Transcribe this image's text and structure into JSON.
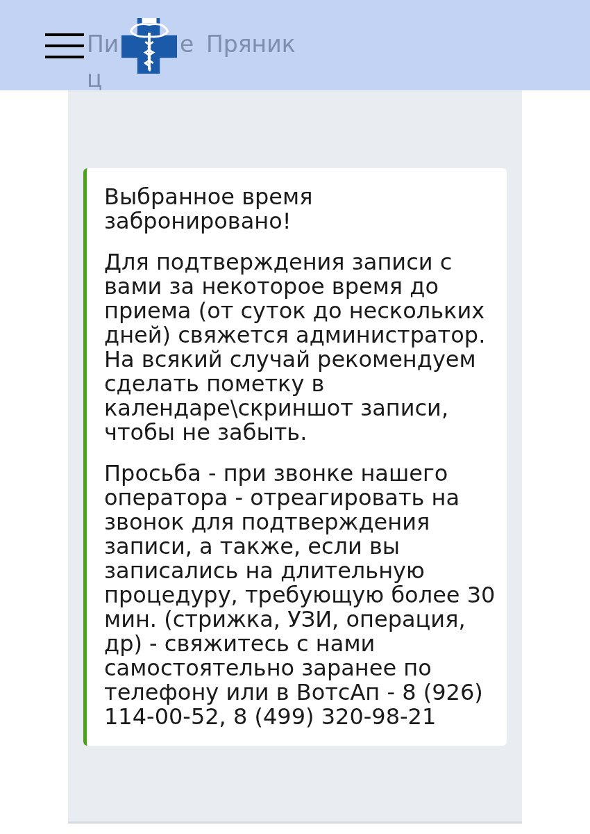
{
  "header": {
    "nav_fragments": [
      "Пи",
      "е",
      "ц"
    ],
    "nav_link": "Пряник"
  },
  "message": {
    "title": "Выбранное время забронировано!",
    "paragraphs": [
      "Для подтверждения записи с вами за некоторое время до приема (от суток до нескольких дней) свяжется администратор. На всякий случай рекомендуем сделать пометку в календаре\\скриншот записи, чтобы не забыть.",
      "Просьба - при звонке нашего оператора - отреагировать на звонок для подтверждения записи, а также, если вы записались на длительную процедуру, требующую более 30 мин. (стрижка, УЗИ, операция, др) - свяжитесь с нами самостоятельно заранее по телефону или в ВотсАп - 8 (926) 114-00-52, 8 (499) 320-98-21"
    ]
  }
}
